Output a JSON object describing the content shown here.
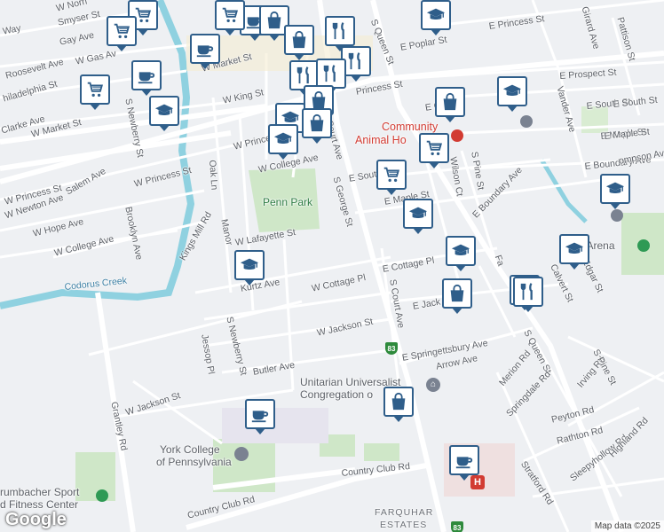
{
  "map": {
    "attribution": "Map data ©2025",
    "logo": "Google",
    "street_labels": [
      {
        "id": "w-norris",
        "text": "W Norri"
      },
      {
        "id": "smyser",
        "text": "Smyser St"
      },
      {
        "id": "gay",
        "text": "Gay Ave"
      },
      {
        "id": "w-way",
        "text": "Way"
      },
      {
        "id": "roosevelt",
        "text": "Roosevelt Ave"
      },
      {
        "id": "w-gas",
        "text": "W Gas Av"
      },
      {
        "id": "w-market-top",
        "text": "W Market St"
      },
      {
        "id": "philadelphia",
        "text": "hiladelphia St"
      },
      {
        "id": "w-king",
        "text": "W King St"
      },
      {
        "id": "clarke",
        "text": "Clarke Ave"
      },
      {
        "id": "w-market-left",
        "text": "W Market St"
      },
      {
        "id": "s-newberry-top",
        "text": "S Newberry St"
      },
      {
        "id": "w-princess-mid",
        "text": "W Princess St"
      },
      {
        "id": "w-princess-left",
        "text": "W Princess St"
      },
      {
        "id": "w-newton",
        "text": "W Newton Ave"
      },
      {
        "id": "salem",
        "text": "Salem Ave"
      },
      {
        "id": "w-princess-low",
        "text": "W Princess St"
      },
      {
        "id": "w-hope",
        "text": "W Hope Ave"
      },
      {
        "id": "w-college-left",
        "text": "W College Ave"
      },
      {
        "id": "brooklyn",
        "text": "Brooklyn Ave"
      },
      {
        "id": "oak-ln",
        "text": "Oak Ln"
      },
      {
        "id": "w-college-mid",
        "text": "W College Ave"
      },
      {
        "id": "penn-park",
        "text": "Penn Park"
      },
      {
        "id": "w-lafayette",
        "text": "W Lafayette St"
      },
      {
        "id": "manor",
        "text": "Manor"
      },
      {
        "id": "kings-mill",
        "text": "Kings Mill Rd"
      },
      {
        "id": "codorus",
        "text": "Codorus Creek"
      },
      {
        "id": "kurtz",
        "text": "Kurtz Ave"
      },
      {
        "id": "w-cottage",
        "text": "W Cottage Pl"
      },
      {
        "id": "s-george",
        "text": "S George St"
      },
      {
        "id": "w-jackson-mid",
        "text": "W Jackson St"
      },
      {
        "id": "s-newberry-low",
        "text": "S Newberry St"
      },
      {
        "id": "jessop",
        "text": "Jessop Pl"
      },
      {
        "id": "butler",
        "text": "Butler Ave"
      },
      {
        "id": "w-jackson-low",
        "text": "W Jackson St"
      },
      {
        "id": "grantley",
        "text": "Grantley Rd"
      },
      {
        "id": "country-club-mid",
        "text": "Country Club Rd"
      },
      {
        "id": "country-club-low",
        "text": "Country Club Rd"
      },
      {
        "id": "s-queen-top",
        "text": "S Queen St"
      },
      {
        "id": "e-princess-top",
        "text": "E Princess St"
      },
      {
        "id": "e-poplar",
        "text": "E Poplar St"
      },
      {
        "id": "e-prospect",
        "text": "E Prospect St"
      },
      {
        "id": "e-princess-mid",
        "text": "Princess St"
      },
      {
        "id": "e-chestnut",
        "text": "E C"
      },
      {
        "id": "court-ave",
        "text": "Court Ave"
      },
      {
        "id": "e-south-right",
        "text": "E South St"
      },
      {
        "id": "e-maple-right",
        "text": "E Maple St"
      },
      {
        "id": "e-boundary",
        "text": "E Boundary Ave"
      },
      {
        "id": "ompson",
        "text": "ompson Ave"
      },
      {
        "id": "e-south-mid",
        "text": "E Sout"
      },
      {
        "id": "e-maple-mid",
        "text": "E Maple St"
      },
      {
        "id": "e-boundary-mid",
        "text": "E Boundary Ave"
      },
      {
        "id": "s-pine-top",
        "text": "S Pine St"
      },
      {
        "id": "wilson",
        "text": "Wilson Ct"
      },
      {
        "id": "e-cottage",
        "text": "E Cottage Pl"
      },
      {
        "id": "s-court-low",
        "text": "S Court Ave"
      },
      {
        "id": "e-jackson",
        "text": "E Jack"
      },
      {
        "id": "e-springettsbury",
        "text": "E Springettsbury Ave"
      },
      {
        "id": "arrow",
        "text": "Arrow Ave"
      },
      {
        "id": "s-queen-low",
        "text": "S Queen St"
      },
      {
        "id": "merion",
        "text": "Merion Rd"
      },
      {
        "id": "springdale",
        "text": "Springdale Rd"
      },
      {
        "id": "irving",
        "text": "Irving Rd"
      },
      {
        "id": "s-pine-low",
        "text": "S Pine St"
      },
      {
        "id": "peyton",
        "text": "Peyton Rd"
      },
      {
        "id": "rathton",
        "text": "Rathton Rd"
      },
      {
        "id": "sleepyhollow",
        "text": "Sleepyhollow Rd"
      },
      {
        "id": "highland",
        "text": "Highland Rd"
      },
      {
        "id": "stratford",
        "text": "Stratford Rd"
      },
      {
        "id": "calvert",
        "text": "Calvert St"
      },
      {
        "id": "edgar",
        "text": "Edgar St"
      },
      {
        "id": "fa",
        "text": "Fa"
      },
      {
        "id": "vander",
        "text": "Vander Ave"
      },
      {
        "id": "girard",
        "text": "Girard Ave"
      },
      {
        "id": "pattison",
        "text": "Pattison St"
      },
      {
        "id": "e-south-far",
        "text": "E South St"
      },
      {
        "id": "e-maple-far",
        "text": "E Maple St"
      },
      {
        "id": "farquhar",
        "text": "FARQUHAR"
      },
      {
        "id": "estates",
        "text": "ESTATES"
      }
    ],
    "pois": [
      {
        "id": "community",
        "text": "Community"
      },
      {
        "id": "animal",
        "text": "Animal Ho"
      },
      {
        "id": "unitarian1",
        "text": "Unitarian Universalist"
      },
      {
        "id": "unitarian2",
        "text": "Congregation o"
      },
      {
        "id": "ycp1",
        "text": "York College"
      },
      {
        "id": "ycp2",
        "text": "of Pennsylvania"
      },
      {
        "id": "brumbacher1",
        "text": "rumbacher Sport"
      },
      {
        "id": "brumbacher2",
        "text": "d Fitness Center"
      },
      {
        "id": "arena",
        "text": "Y  e Arena"
      }
    ],
    "highway": "83",
    "markers": [
      {
        "icon": "cart-icon"
      },
      {
        "icon": "cart-icon"
      },
      {
        "icon": "coffee-icon"
      },
      {
        "icon": "graduation-cap-icon"
      },
      {
        "icon": "cart-icon"
      },
      {
        "icon": "coffee-icon"
      },
      {
        "icon": "graduation-cap-icon"
      },
      {
        "icon": "coffee-icon"
      },
      {
        "icon": "shopping-bag-icon"
      },
      {
        "icon": "cart-icon"
      },
      {
        "icon": "shopping-bag-icon"
      },
      {
        "icon": "restaurant-icon"
      },
      {
        "icon": "restaurant-icon"
      },
      {
        "icon": "restaurant-icon"
      },
      {
        "icon": "restaurant-icon"
      },
      {
        "icon": "shopping-bag-icon"
      },
      {
        "icon": "graduation-cap-icon"
      },
      {
        "icon": "graduation-cap-icon"
      },
      {
        "icon": "shopping-bag-icon"
      },
      {
        "icon": "graduation-cap-icon"
      },
      {
        "icon": "shopping-bag-icon"
      },
      {
        "icon": "graduation-cap-icon"
      },
      {
        "icon": "cart-icon"
      },
      {
        "icon": "cart-icon"
      },
      {
        "icon": "graduation-cap-icon"
      },
      {
        "icon": "graduation-cap-icon"
      },
      {
        "icon": "graduation-cap-icon"
      },
      {
        "icon": "graduation-cap-icon"
      },
      {
        "icon": "graduation-cap-icon"
      },
      {
        "icon": "shopping-bag-icon"
      },
      {
        "icon": "restaurant-icon"
      },
      {
        "icon": "shopping-bag-icon"
      },
      {
        "icon": "coffee-icon"
      },
      {
        "icon": "coffee-icon"
      }
    ]
  }
}
